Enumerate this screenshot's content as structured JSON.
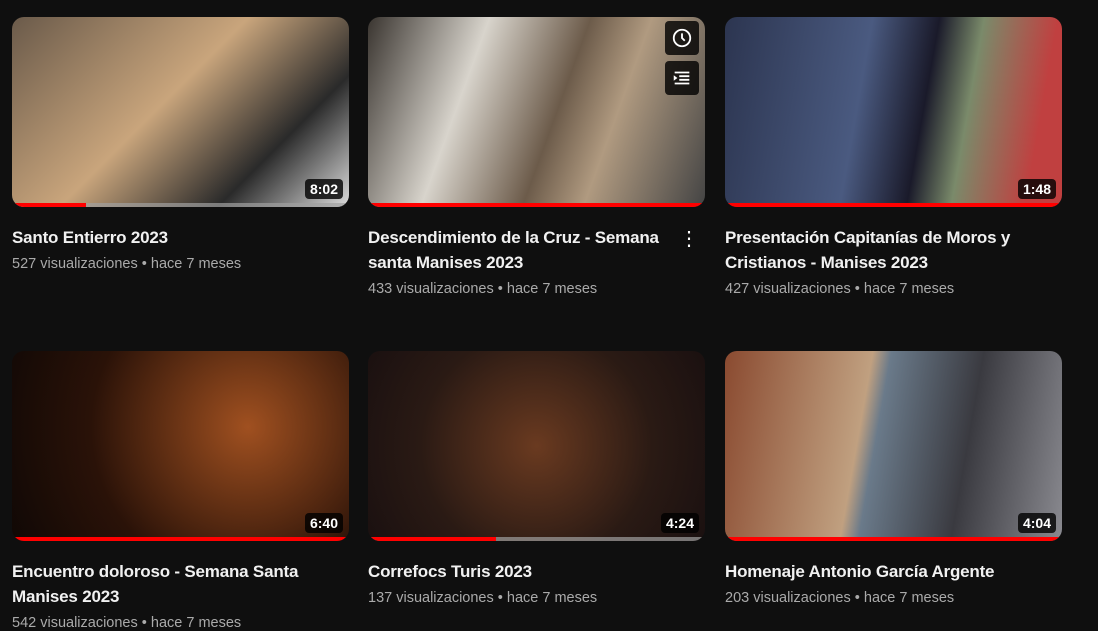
{
  "videos": [
    {
      "title": "Santo Entierro 2023",
      "views": "527 visualizaciones",
      "age": "hace 7 meses",
      "duration": "8:02",
      "progress": 0.22,
      "bg": "linear-gradient(135deg,#6a5a4a,#c9a57c 45%,#2a2a2a 75%,#ddd)"
    },
    {
      "title": "Descendimiento de la Cruz - Semana santa Manises 2023",
      "views": "433 visualizaciones",
      "age": "hace 7 meses",
      "duration": "",
      "progress": 1,
      "bg": "linear-gradient(110deg,#3a3530,#d8d4cc 30%,#6c5b4a 55%,#b09a80 70%,#444)"
    },
    {
      "title": "Presentación Capitanías de Moros y Cristianos - Manises 2023",
      "views": "427 visualizaciones",
      "age": "hace 7 meses",
      "duration": "1:48",
      "progress": 1,
      "bg": "linear-gradient(100deg,#2c3550,#4a5a80 40%,#1a1a2a 58%,#7a8a6a 70%,#c04040 90%)"
    },
    {
      "title": "Encuentro doloroso - Semana Santa Manises 2023",
      "views": "542 visualizaciones",
      "age": "hace 7 meses",
      "duration": "6:40",
      "progress": 1,
      "bg": "radial-gradient(circle at 70% 40%,#a05020,#2a1208 60%,#100805)"
    },
    {
      "title": "Correfocs Turis 2023",
      "views": "137 visualizaciones",
      "age": "hace 7 meses",
      "duration": "4:24",
      "progress": 0.38,
      "bg": "radial-gradient(circle at 50% 50%,#6a3a20,#2a1a14 60%,#1a1010)"
    },
    {
      "title": "Homenaje Antonio García Argente",
      "views": "203 visualizaciones",
      "age": "hace 7 meses",
      "duration": "4:04",
      "progress": 1,
      "bg": "linear-gradient(100deg,#8a4a30,#c0a080 40%,#6a7a8a 45%,#3a3a40 70%,#8a8a90)"
    }
  ],
  "separator": "•",
  "colors": {
    "background": "#0f0f0f",
    "progress": "#ff0000",
    "meta": "#aaaaaa"
  }
}
